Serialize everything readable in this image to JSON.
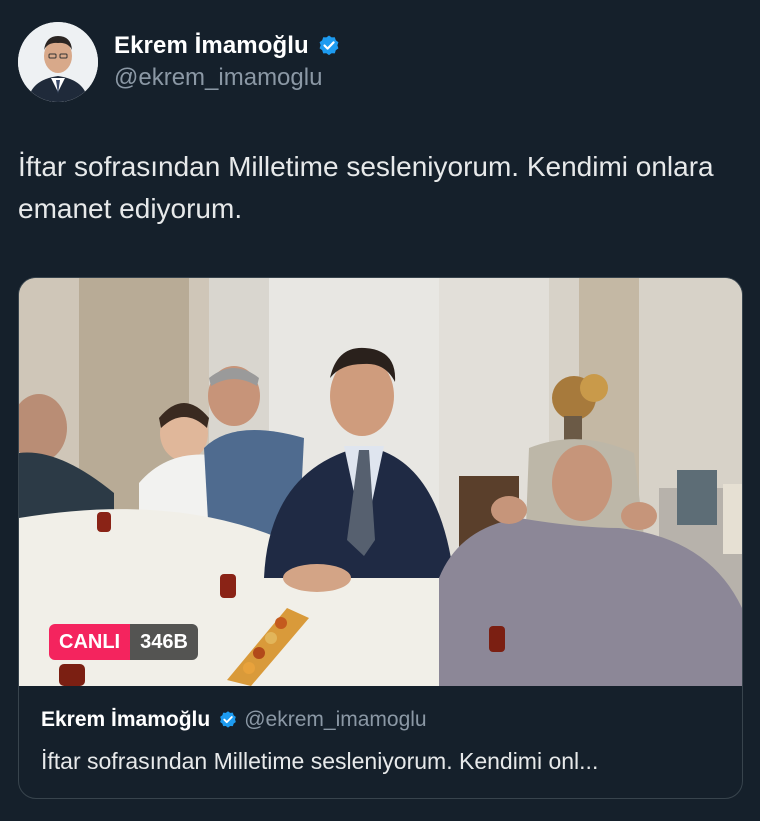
{
  "author": {
    "display_name": "Ekrem İmamoğlu",
    "handle": "@ekrem_imamoglu",
    "verified_icon": "verified-badge-icon",
    "verified_color": "#1d9bf0"
  },
  "tweet": {
    "text": "İftar sofrasından Milletime sesleniyorum. Kendimi onlara emanet ediyorum."
  },
  "embed": {
    "live_label": "CANLI",
    "viewer_count": "346B",
    "display_name": "Ekrem İmamoğlu",
    "handle": "@ekrem_imamoglu",
    "text_preview": "İftar sofrasından Milletime sesleniyorum. Kendimi onl..."
  },
  "colors": {
    "background": "#15202b",
    "live_red": "#f4245e",
    "secondary_text": "#8b98a5"
  }
}
